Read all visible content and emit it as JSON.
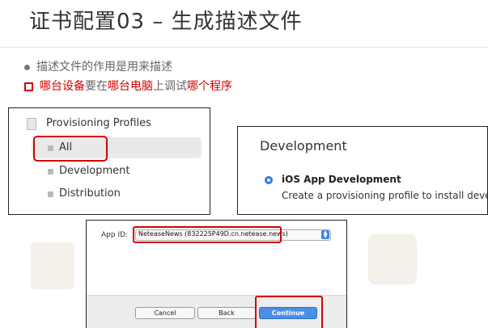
{
  "slide": {
    "title": "证书配置03 – 生成描述文件",
    "bullet1": "描述文件的作用是用来描述",
    "bullet2": {
      "p1": "哪台设备",
      "p2": "要在",
      "p3": "哪台电脑",
      "p4": "上调试",
      "p5": "哪个程序"
    }
  },
  "profiles": {
    "header": "Provisioning Profiles",
    "items": [
      "All",
      "Development",
      "Distribution"
    ],
    "selected": "All"
  },
  "development": {
    "heading": "Development",
    "option_title": "iOS App Development",
    "option_desc": "Create a provisioning profile to install development"
  },
  "appid": {
    "label": "App ID:",
    "value": "NeteaseNews (832225P49D.cn.netease.news)",
    "buttons": {
      "cancel": "Cancel",
      "back": "Back",
      "continue": "Continue"
    }
  },
  "colors": {
    "highlight_red": "#d40000",
    "accent_blue": "#2a80d6"
  }
}
